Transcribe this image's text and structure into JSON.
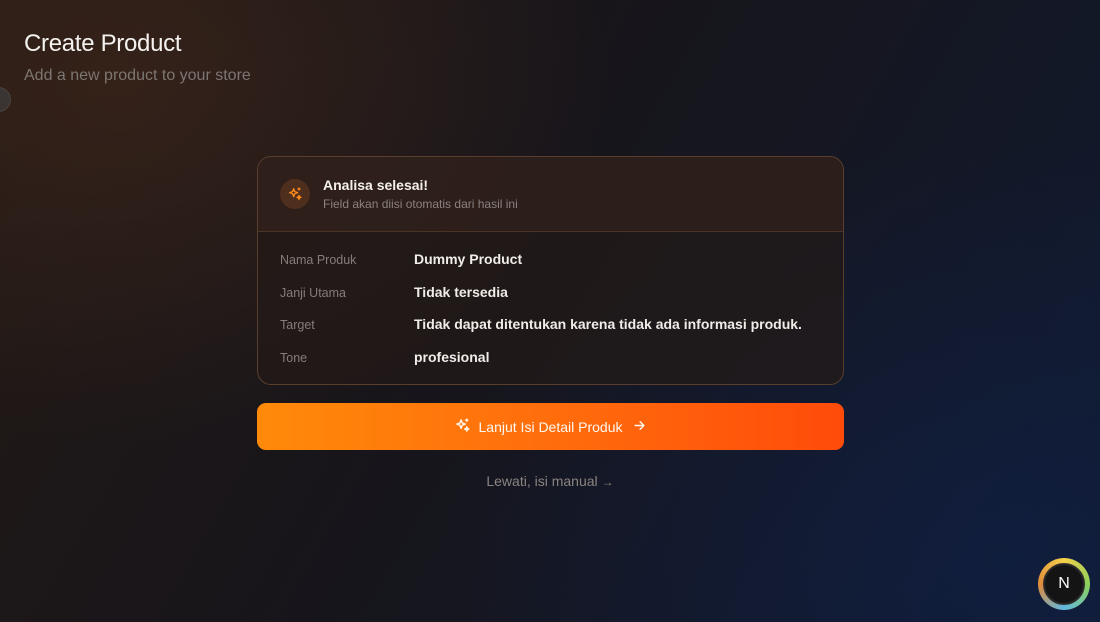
{
  "header": {
    "title": "Create Product",
    "subtitle": "Add a new product to your store"
  },
  "analysis": {
    "icon": "sparkles-icon",
    "title": "Analisa selesai!",
    "subtitle": "Field akan diisi otomatis dari hasil ini",
    "fields": [
      {
        "label": "Nama Produk",
        "value": "Dummy Product"
      },
      {
        "label": "Janji Utama",
        "value": "Tidak tersedia"
      },
      {
        "label": "Target",
        "value": "Tidak dapat ditentukan karena tidak ada informasi produk."
      },
      {
        "label": "Tone",
        "value": "profesional"
      }
    ]
  },
  "actions": {
    "continue_label": "Lanjut Isi Detail Produk",
    "continue_icon": "sparkles-icon",
    "continue_arrow": "→",
    "skip_label": "Lewati, isi manual",
    "skip_arrow": "→"
  },
  "assistant": {
    "initial": "N"
  },
  "colors": {
    "accent": "#ff7a0a",
    "accent_end": "#ff4b0a",
    "card_border": "#5a3e2c"
  }
}
